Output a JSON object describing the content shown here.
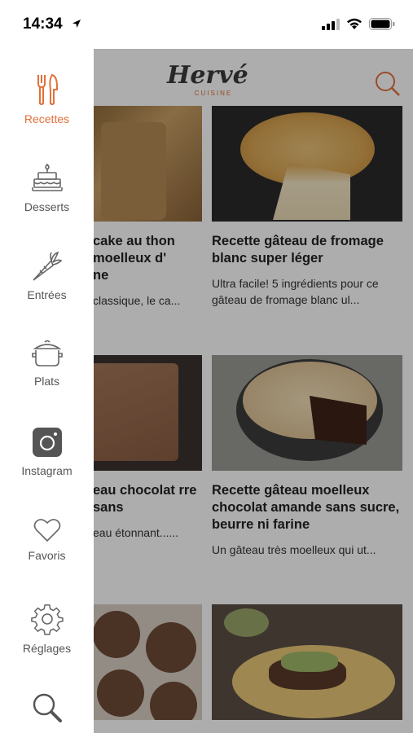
{
  "status": {
    "time": "14:34"
  },
  "header": {
    "logo": "Hervé",
    "logo_sub": "CUISINE"
  },
  "drawer": {
    "items": [
      {
        "label": "Recettes",
        "icon": "cutlery-icon"
      },
      {
        "label": "Desserts",
        "icon": "cake-icon"
      },
      {
        "label": "Entrées",
        "icon": "carrot-icon"
      },
      {
        "label": "Plats",
        "icon": "pot-icon"
      },
      {
        "label": "Instagram",
        "icon": "instagram-icon"
      },
      {
        "label": "Favoris",
        "icon": "heart-icon"
      },
      {
        "label": "Réglages",
        "icon": "gear-icon"
      }
    ],
    "active_color": "#e2703a"
  },
  "cards": [
    {
      "title": "cake au thon moelleux d'\nne",
      "desc": "classique, le ca..."
    },
    {
      "title": "Recette gâteau de fromage blanc super léger",
      "desc": "Ultra facile! 5 ingrédients pour ce gâteau de fromage blanc ul..."
    },
    {
      "title": "eau chocolat rre sans",
      "desc": "eau étonnant......"
    },
    {
      "title": "Recette gâteau moelleux chocolat amande sans sucre, beurre ni farine",
      "desc": "Un gâteau très moelleux qui ut..."
    }
  ]
}
